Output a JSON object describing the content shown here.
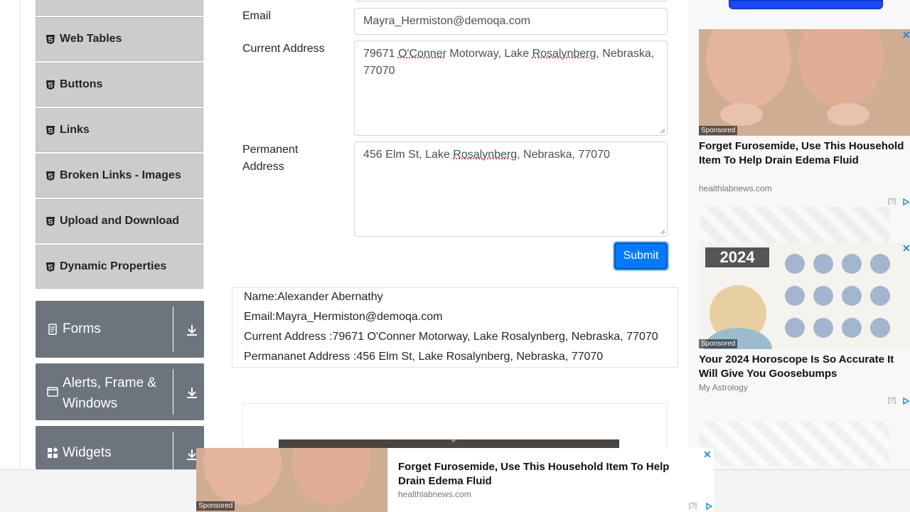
{
  "sidebar": {
    "elements_items": [
      {
        "label": ""
      },
      {
        "label": "Web Tables"
      },
      {
        "label": "Buttons"
      },
      {
        "label": "Links"
      },
      {
        "label": "Broken Links - Images"
      },
      {
        "label": "Upload and Download"
      },
      {
        "label": "Dynamic Properties"
      }
    ],
    "groups": [
      {
        "label": "Forms"
      },
      {
        "label": "Alerts, Frame &",
        "label2": "Windows"
      },
      {
        "label": "Widgets"
      }
    ]
  },
  "form": {
    "email_label": "Email",
    "email_value": "Mayra_Hermiston@demoqa.com",
    "current_label": "Current Address",
    "current_value_parts": [
      "79671 ",
      "O'Conner",
      " Motorway, Lake ",
      "Rosalynberg",
      ", Nebraska,",
      "77070"
    ],
    "permanent_label": "Permanent",
    "permanent_label2": "Address",
    "permanent_value_parts": [
      "456 Elm St, Lake ",
      "Rosalynberg",
      ", Nebraska, 77070"
    ],
    "submit_label": "Submit"
  },
  "output": {
    "name": "Name:Alexander Abernathy",
    "email": "Email:Mayra_Hermiston@demoqa.com",
    "current": "Current Address :79671 O'Conner Motorway, Lake Rosalynberg, Nebraska, 77070",
    "permanent": "Permananet Address :456 Elm St, Lake Rosalynberg, Nebraska, 77070"
  },
  "ads": {
    "right": [
      {
        "sponsored": "Sponsored",
        "title": "Forget Furosemide, Use This Household Item To Help Drain Edema Fluid",
        "source": "healthlabnews.com",
        "q": "[?]"
      },
      {
        "sponsored": "Sponsored",
        "title": "Your 2024 Horoscope Is So Accurate It Will Give You Goosebumps",
        "source": "My Astrology",
        "q": "[?]",
        "year": "2024"
      }
    ],
    "sticky": {
      "sponsored": "Sponsored",
      "title": "Forget Furosemide, Use This Household Item To Help Drain Edema Fluid",
      "source": "healthlabnews.com",
      "q": "[?]"
    },
    "close": "✕"
  },
  "colors": {
    "primary": "#007bff",
    "group_bg": "#6c757d",
    "menu_bg": "#cccccc"
  }
}
